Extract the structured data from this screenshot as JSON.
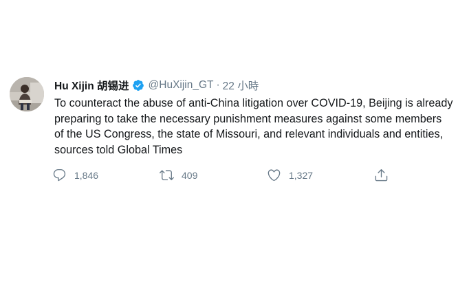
{
  "tweet": {
    "display_name": "Hu Xijin 胡锡进",
    "handle": "@HuXijin_GT",
    "separator": "·",
    "timestamp": "22 小時",
    "text": "To counteract the abuse of anti-China litigation over COVID-19, Beijing is already preparing to take the necessary punishment measures against some members of the US Congress, the state of Missouri, and relevant individuals and entities, sources told Global Times",
    "verified": true,
    "accent_color": "#1da1f2",
    "actions": {
      "reply": {
        "icon": "reply-icon",
        "count": "1,846"
      },
      "retweet": {
        "icon": "retweet-icon",
        "count": "409"
      },
      "like": {
        "icon": "heart-icon",
        "count": "1,327"
      },
      "share": {
        "icon": "share-icon"
      }
    }
  }
}
